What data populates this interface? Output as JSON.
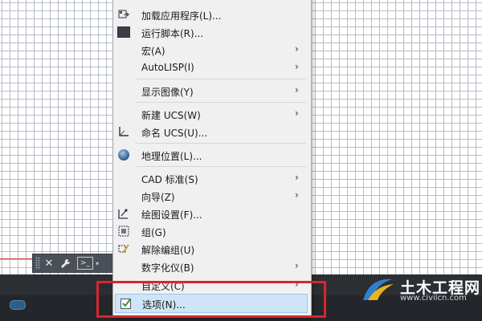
{
  "menu": {
    "items": [
      {
        "label": "加载应用程序(L)...",
        "icon": "load-app-icon",
        "submenu": false
      },
      {
        "label": "运行脚本(R)...",
        "icon": "run-script-icon",
        "submenu": false
      },
      {
        "label": "宏(A)",
        "icon": "",
        "submenu": true
      },
      {
        "label": "AutoLISP(I)",
        "icon": "",
        "submenu": true
      },
      {
        "label": "显示图像(Y)",
        "icon": "",
        "submenu": true
      },
      {
        "label": "新建 UCS(W)",
        "icon": "",
        "submenu": true
      },
      {
        "label": "命名 UCS(U)...",
        "icon": "named-ucs-icon",
        "submenu": false
      },
      {
        "label": "地理位置(L)...",
        "icon": "globe-icon",
        "submenu": false
      },
      {
        "label": "CAD 标准(S)",
        "icon": "",
        "submenu": true
      },
      {
        "label": "向导(Z)",
        "icon": "",
        "submenu": true
      },
      {
        "label": "绘图设置(F)...",
        "icon": "drafting-settings-icon",
        "submenu": false
      },
      {
        "label": "组(G)",
        "icon": "group-icon",
        "submenu": false
      },
      {
        "label": "解除编组(U)",
        "icon": "ungroup-icon",
        "submenu": false
      },
      {
        "label": "数字化仪(B)",
        "icon": "",
        "submenu": true
      },
      {
        "label": "自定义(C)",
        "icon": "",
        "submenu": true
      },
      {
        "label": "选项(N)...",
        "icon": "options-check-icon",
        "submenu": false,
        "selected": true
      }
    ],
    "arrow_glyph": "›"
  },
  "toolbar": {
    "close_glyph": "✕",
    "wrench_glyph": "🔧",
    "prompt_glyph": ">_",
    "caret_glyph": "▾"
  },
  "watermark": {
    "title": "土木工程网",
    "url": "www.civilcn.com"
  },
  "colors": {
    "highlight": "#d8262b",
    "selection": "#cfe4f7",
    "status_bar": "#2b2e33"
  }
}
